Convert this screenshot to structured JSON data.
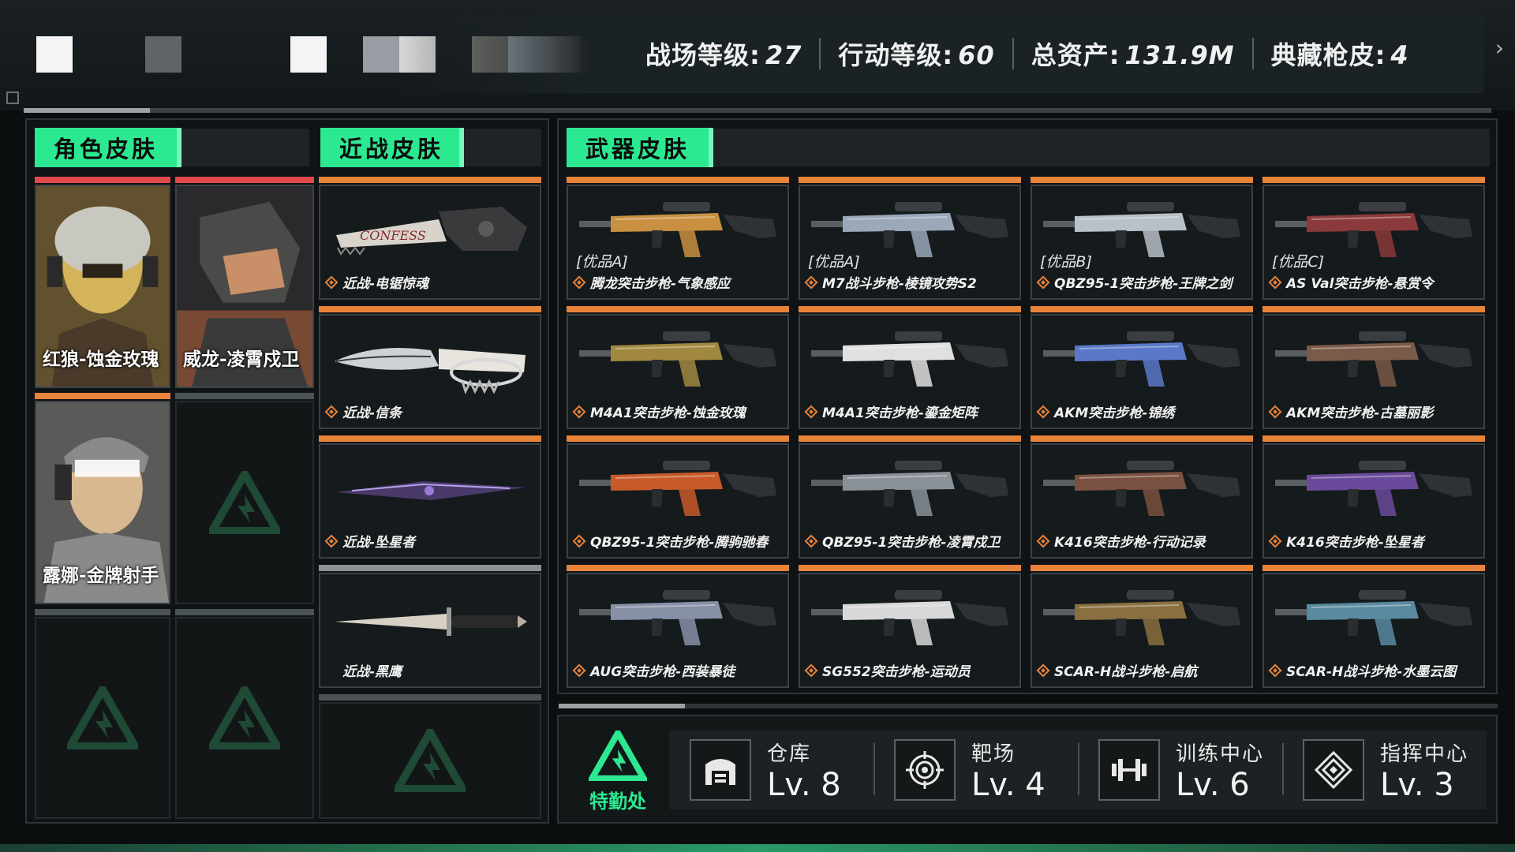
{
  "header": {
    "stats": [
      {
        "label": "战场等级",
        "value": "27"
      },
      {
        "label": "行动等级",
        "value": "60"
      },
      {
        "label": "总资产",
        "value": "131.9M"
      },
      {
        "label": "典藏枪皮",
        "value": "4"
      }
    ],
    "separator": ":"
  },
  "sections": {
    "character": "角色皮肤",
    "melee": "近战皮肤",
    "weapon": "武器皮肤"
  },
  "characters": [
    {
      "name": "红狼-蚀金玫瑰",
      "bar": "red",
      "palette": [
        "#b08a3a",
        "#4a3a2a",
        "#d4b45a"
      ]
    },
    {
      "name": "威龙-凌霄戍卫",
      "bar": "red",
      "palette": [
        "#3a3a3a",
        "#c86a3a",
        "#e8a070"
      ]
    },
    {
      "name": "露娜-金牌射手",
      "bar": "orange",
      "palette": [
        "#8a8a8a",
        "#d8b890",
        "#ffffff"
      ]
    }
  ],
  "melee": [
    {
      "name": "近战-电锯惊魂",
      "icon": "chainsaw-icon"
    },
    {
      "name": "近战-信条",
      "icon": "knife-icon"
    },
    {
      "name": "近战-坠星者",
      "icon": "blade-icon"
    },
    {
      "name": "近战-黑鹰",
      "icon": "dagger-icon"
    }
  ],
  "weapons": [
    {
      "grade": "[优品A]",
      "name": "腾龙突击步枪-气象感应",
      "color": "#c89040"
    },
    {
      "grade": "[优品A]",
      "name": "M7战斗步枪-棱镜攻势S2",
      "color": "#9aa8b8"
    },
    {
      "grade": "[优品B]",
      "name": "QBZ95-1突击步枪-王牌之剑",
      "color": "#b8c0c8"
    },
    {
      "grade": "[优品C]",
      "name": "AS Val突击步枪-悬赏令",
      "color": "#8a3a3a"
    },
    {
      "grade": "",
      "name": "M4A1突击步枪-蚀金玫瑰",
      "color": "#a08840"
    },
    {
      "grade": "",
      "name": "M4A1突击步枪-鎏金矩阵",
      "color": "#e0e0e0"
    },
    {
      "grade": "",
      "name": "AKM突击步枪-锦绣",
      "color": "#5a78c8"
    },
    {
      "grade": "",
      "name": "AKM突击步枪-古墓丽影",
      "color": "#7a5a48"
    },
    {
      "grade": "",
      "name": "QBZ95-1突击步枪-腾驹驰春",
      "color": "#c85a2a"
    },
    {
      "grade": "",
      "name": "QBZ95-1突击步枪-凌霄戍卫",
      "color": "#8a9098"
    },
    {
      "grade": "",
      "name": "K416突击步枪-行动记录",
      "color": "#7a5040"
    },
    {
      "grade": "",
      "name": "K416突击步枪-坠星者",
      "color": "#6a4a9a"
    },
    {
      "grade": "",
      "name": "AUG突击步枪-西装暴徒",
      "color": "#8890a8"
    },
    {
      "grade": "",
      "name": "SG552突击步枪-运动员",
      "color": "#d8d8d8"
    },
    {
      "grade": "",
      "name": "SCAR-H战斗步枪-启航",
      "color": "#8a7040"
    },
    {
      "grade": "",
      "name": "SCAR-H战斗步枪-水墨云图",
      "color": "#5a8aa0"
    }
  ],
  "facilities_panel": {
    "hq_label": "特勤处",
    "items": [
      {
        "name": "仓库",
        "level": "Lv. 8",
        "icon": "warehouse-icon"
      },
      {
        "name": "靶场",
        "level": "Lv. 4",
        "icon": "target-icon"
      },
      {
        "name": "训练中心",
        "level": "Lv. 6",
        "icon": "dumbbell-icon"
      },
      {
        "name": "指挥中心",
        "level": "Lv. 3",
        "icon": "command-icon"
      }
    ]
  },
  "colors": {
    "accent_green": "#2ce890",
    "tile_bar_orange": "#e8833a",
    "tile_bar_red": "#e04a4a"
  }
}
